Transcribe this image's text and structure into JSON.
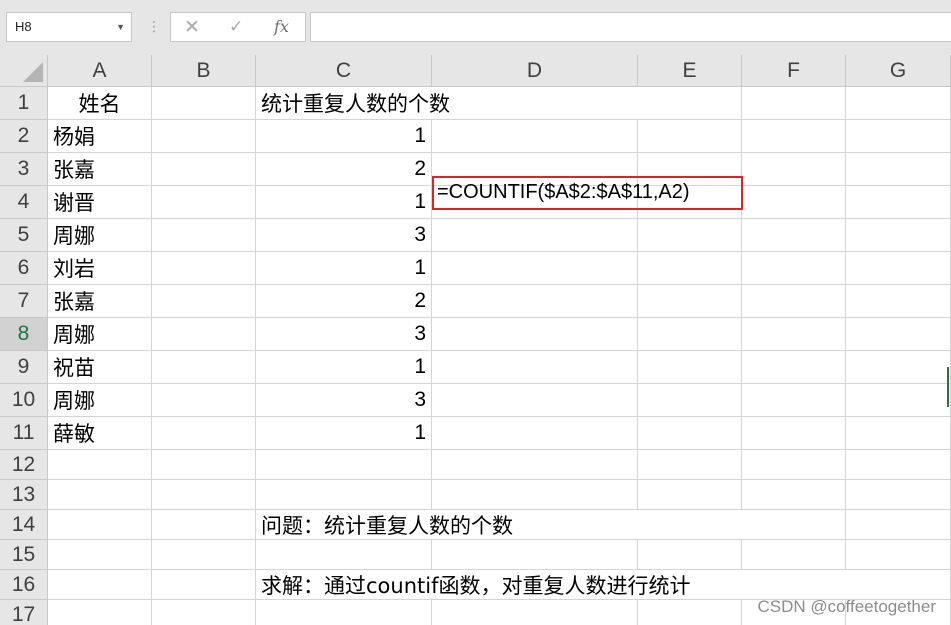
{
  "name_box": {
    "value": "H8",
    "dropdown_icon": "chevron-down-icon"
  },
  "formula_bar": {
    "menu_icon": "vertical-dots-icon",
    "cancel_icon": "close-icon",
    "enter_icon": "check-icon",
    "fx_label": "fx",
    "value": ""
  },
  "columns": [
    "A",
    "B",
    "C",
    "D",
    "E",
    "F",
    "G"
  ],
  "rows": [
    "1",
    "2",
    "3",
    "4",
    "5",
    "6",
    "7",
    "8",
    "9",
    "10",
    "11",
    "12",
    "13",
    "14",
    "15",
    "16",
    "17"
  ],
  "active_cell": {
    "column": "H",
    "row": "8"
  },
  "cells": {
    "A1": "姓名",
    "C1": "统计重复人数的个数",
    "A2": "杨娟",
    "C2": "1",
    "A3": "张嘉",
    "C3": "2",
    "A4": "谢晋",
    "C4": "1",
    "A5": "周娜",
    "C5": "3",
    "A6": "刘岩",
    "C6": "1",
    "A7": "张嘉",
    "C7": "2",
    "A8": "周娜",
    "C8": "3",
    "A9": "祝苗",
    "C9": "1",
    "A10": "周娜",
    "C10": "3",
    "A11": "薛敏",
    "C11": "1",
    "C14": "问题：统计重复人数的个数",
    "C16": "求解：通过countif函数，对重复人数进行统计"
  },
  "formula_annotation": {
    "text": "=COUNTIF($A$2:$A$11,A2)",
    "border_color": "#d9242a"
  },
  "watermark": "CSDN @coffeetogether",
  "colors": {
    "header_bg": "#e6e6e6",
    "gridline": "#d4d4d4",
    "active_row_text": "#217346"
  }
}
